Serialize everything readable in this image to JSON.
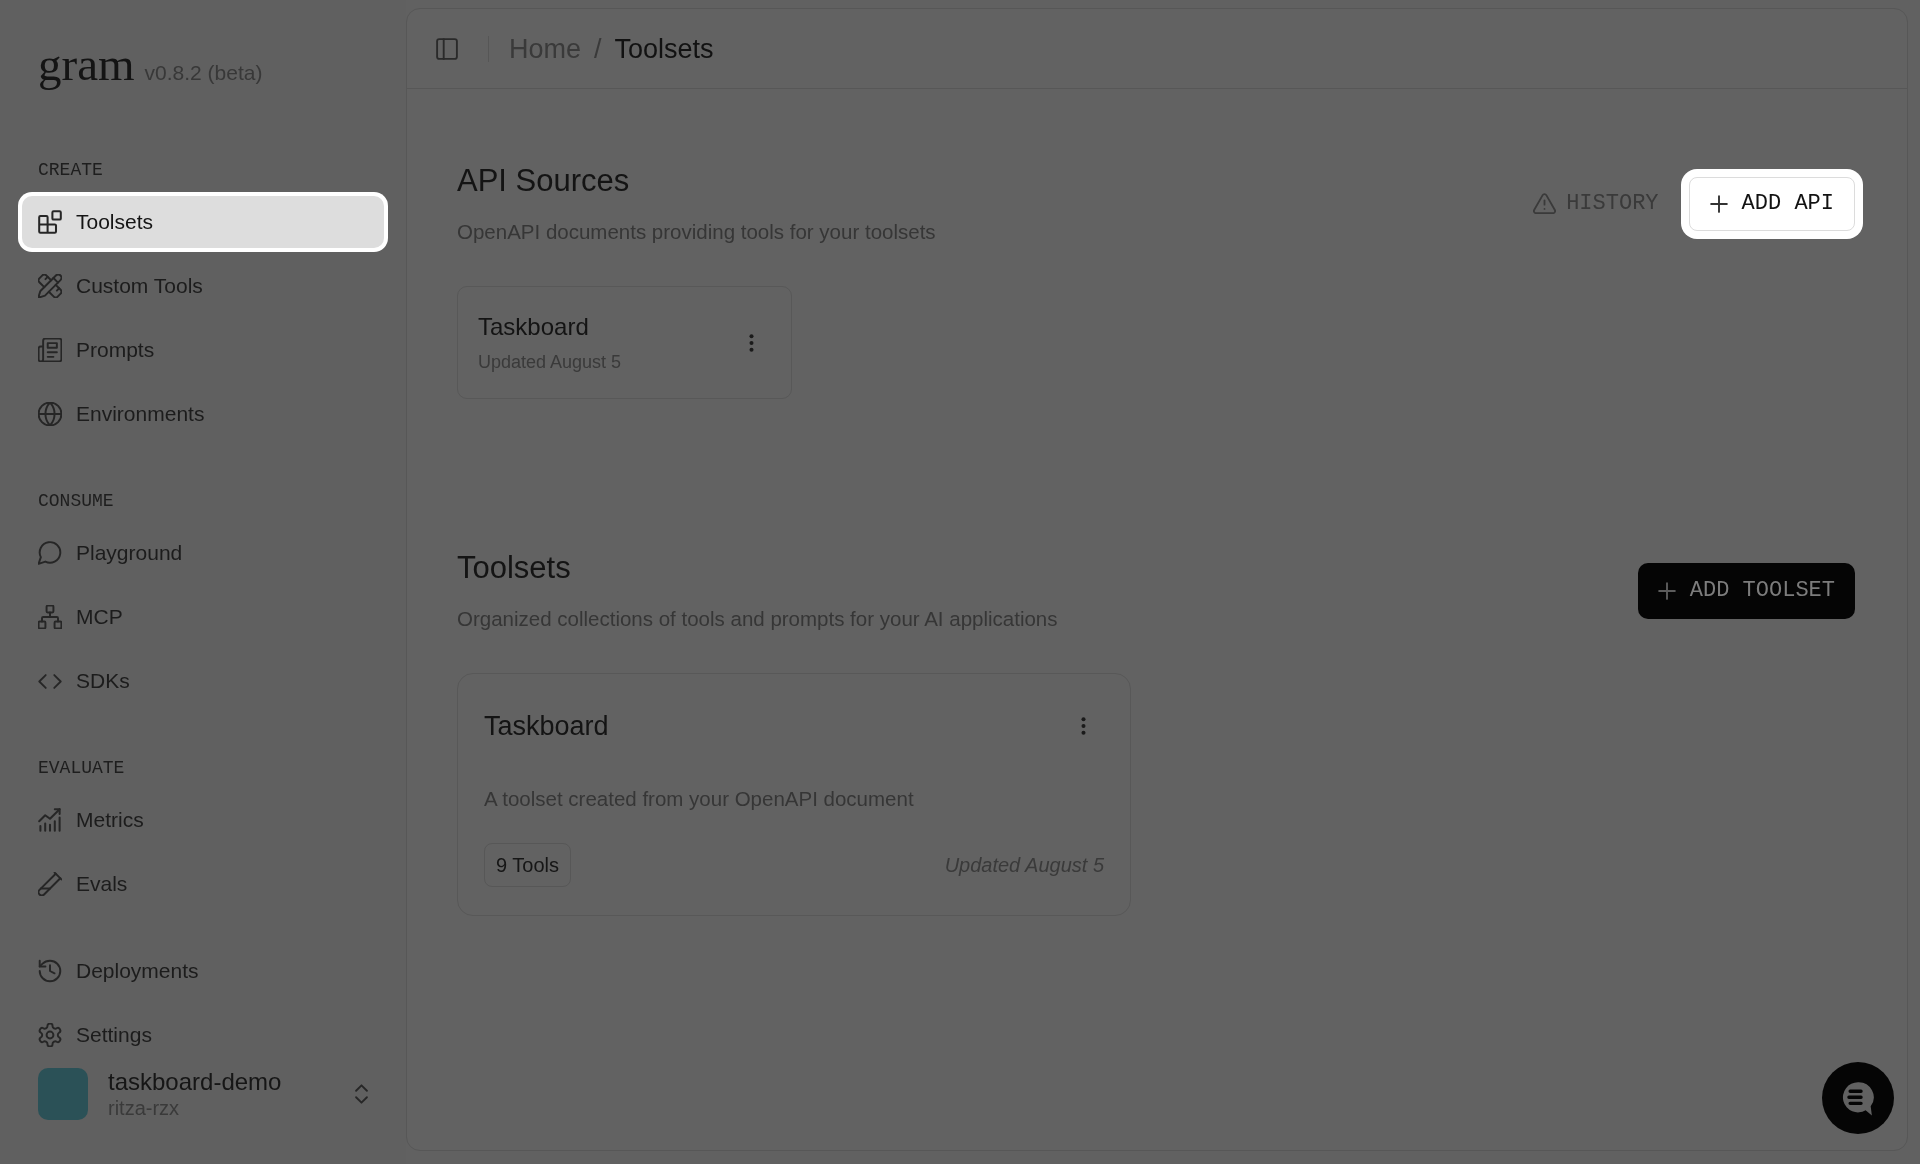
{
  "brand": {
    "logo": "gram",
    "version": "v0.8.2 (beta)"
  },
  "sidebar": {
    "sections": [
      {
        "label": "CREATE",
        "items": [
          {
            "label": "Toolsets",
            "selected": true
          },
          {
            "label": "Custom Tools",
            "selected": false
          },
          {
            "label": "Prompts",
            "selected": false
          },
          {
            "label": "Environments",
            "selected": false
          }
        ]
      },
      {
        "label": "CONSUME",
        "items": [
          {
            "label": "Playground",
            "selected": false
          },
          {
            "label": "MCP",
            "selected": false
          },
          {
            "label": "SDKs",
            "selected": false
          }
        ]
      },
      {
        "label": "EVALUATE",
        "items": [
          {
            "label": "Metrics",
            "selected": false
          },
          {
            "label": "Evals",
            "selected": false
          }
        ]
      },
      {
        "items": [
          {
            "label": "Deployments",
            "selected": false
          },
          {
            "label": "Settings",
            "selected": false
          }
        ]
      }
    ],
    "workspace": {
      "name": "taskboard-demo",
      "org": "ritza-rzx"
    }
  },
  "header": {
    "breadcrumb": [
      {
        "label": "Home",
        "current": false
      },
      {
        "label": "Toolsets",
        "current": true
      }
    ],
    "separator": "/"
  },
  "api_sources": {
    "title": "API Sources",
    "subtitle": "OpenAPI documents providing tools for your toolsets",
    "actions": [
      {
        "kind": "ghost",
        "label": "HISTORY",
        "highlighted": false
      },
      {
        "kind": "outline",
        "label": "ADD API",
        "highlighted": true
      }
    ],
    "cards": [
      {
        "title": "Taskboard",
        "updated": "Updated August 5"
      }
    ]
  },
  "toolsets": {
    "title": "Toolsets",
    "subtitle": "Organized collections of tools and prompts for your AI applications",
    "actions": [
      {
        "kind": "primary",
        "label": "ADD TOOLSET",
        "highlighted": false
      }
    ],
    "cards": [
      {
        "title": "Taskboard",
        "description": "A toolset created from your OpenAPI document",
        "tool_count": "9 Tools",
        "updated": "Updated August 5"
      }
    ]
  }
}
